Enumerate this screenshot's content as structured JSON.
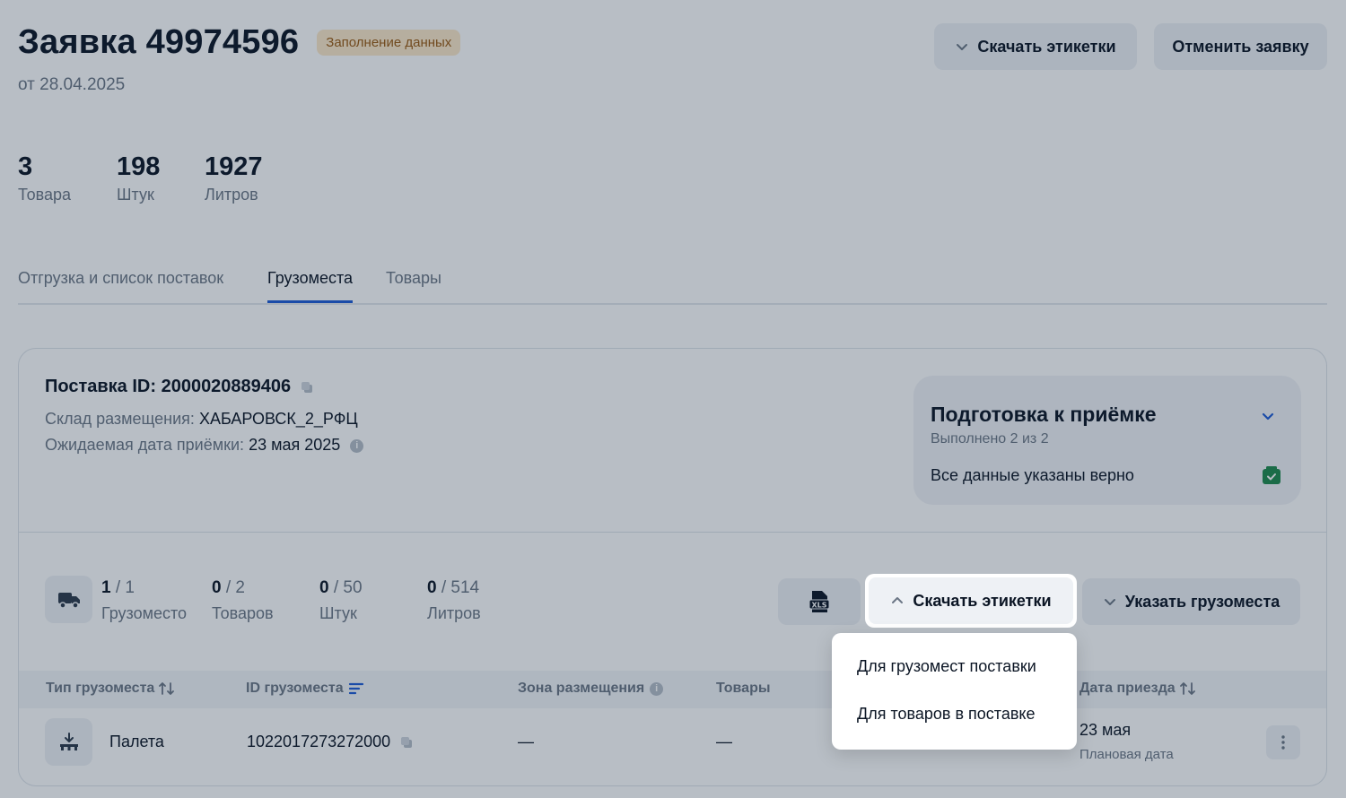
{
  "header": {
    "title": "Заявка 49974596",
    "status": "Заполнение данных",
    "date": "от 28.04.2025",
    "download_labels": "Скачать этикетки",
    "cancel": "Отменить заявку"
  },
  "stats": [
    {
      "value": "3",
      "label": "Товара"
    },
    {
      "value": "198",
      "label": "Штук"
    },
    {
      "value": "1927",
      "label": "Литров"
    }
  ],
  "tabs": [
    {
      "label": "Отгрузка и список поставок",
      "active": false
    },
    {
      "label": "Грузоместа",
      "active": true
    },
    {
      "label": "Товары",
      "active": false
    }
  ],
  "supply": {
    "id_label": "Поставка ID: 2000020889406",
    "warehouse_label": "Склад размещения:",
    "warehouse_value": "ХАБАРОВСК_2_РФЦ",
    "date_label": "Ожидаемая дата приёмки:",
    "date_value": "23 мая 2025"
  },
  "prep": {
    "title": "Подготовка к приёмке",
    "progress": "Выполнено 2 из 2",
    "check": "Все данные указаны верно"
  },
  "counters": [
    {
      "done": "1",
      "total": "/ 1",
      "label": "Грузоместо"
    },
    {
      "done": "0",
      "total": "/ 2",
      "label": "Товаров"
    },
    {
      "done": "0",
      "total": "/ 50",
      "label": "Штук"
    },
    {
      "done": "0",
      "total": "/ 514",
      "label": "Литров"
    }
  ],
  "actions": {
    "xls": "XLS",
    "download_labels": "Скачать этикетки",
    "specify_places": "Указать грузоместа"
  },
  "table": {
    "headers": [
      "Тип грузоместа",
      "ID грузоместа",
      "Зона размещения",
      "Товары",
      "Дата приезда"
    ],
    "row": {
      "type": "Палета",
      "id": "1022017273272000",
      "zone": "—",
      "goods": "—",
      "date": "23 мая",
      "date_note": "Плановая дата"
    }
  },
  "dropdown": {
    "items": [
      "Для грузомест поставки",
      "Для товаров в поставке"
    ]
  },
  "colors": {
    "accent": "#1d5bd6",
    "badge_bg": "#fde9c9",
    "badge_text": "#9a5a12",
    "success": "#1f8a4c",
    "overlay": "rgba(20,40,64,0.30)"
  }
}
